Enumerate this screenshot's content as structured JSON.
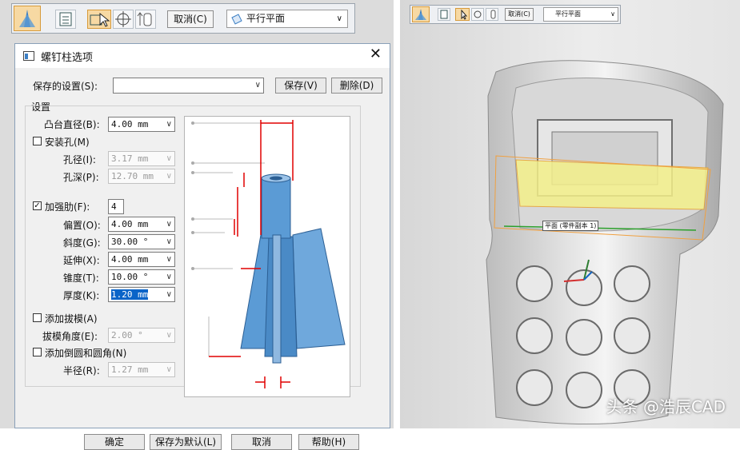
{
  "toolbar": {
    "cancel_label": "取消(C)",
    "plane_option": "平行平面"
  },
  "dialog": {
    "title": "螺钉柱选项",
    "saved_settings_label": "保存的设置(S):",
    "saved_settings_value": "",
    "save_label": "保存(V)",
    "delete_label": "删除(D)",
    "settings_group_label": "设置",
    "boss_diameter_label": "凸台直径(B):",
    "boss_diameter_value": "4.00 mm",
    "mounting_hole_label": "安装孔(M)",
    "mounting_hole_checked": false,
    "hole_diameter_label": "孔径(I):",
    "hole_diameter_value": "3.17 mm",
    "hole_depth_label": "孔深(P):",
    "hole_depth_value": "12.70 mm",
    "ribs_label": "加强肋(F):",
    "ribs_checked": true,
    "ribs_count": "4",
    "offset_label": "偏置(O):",
    "offset_value": "4.00 mm",
    "slope_label": "斜度(G):",
    "slope_value": "30.00 °",
    "extension_label": "延伸(X):",
    "extension_value": "4.00 mm",
    "taper_label": "锥度(T):",
    "taper_value": "10.00 °",
    "thickness_label": "厚度(K):",
    "thickness_value": "1.20 mm",
    "draft_label": "添加拔模(A)",
    "draft_checked": false,
    "draft_angle_label": "拔模角度(E):",
    "draft_angle_value": "2.00 °",
    "fillet_label": "添加倒圆和圆角(N)",
    "fillet_checked": false,
    "radius_label": "半径(R):",
    "radius_value": "1.27 mm",
    "ok_label": "确定",
    "save_default_label": "保存为默认(L)",
    "cancel_label": "取消",
    "help_label": "帮助(H)"
  },
  "viewport": {
    "toolbar_cancel_label": "取消(C)",
    "toolbar_plane_option": "平行平面",
    "plane_tag": "平面 (零件副本 1)",
    "watermark": "头条 @浩辰CAD"
  },
  "colors": {
    "accent": "#f7d9a3",
    "boss_blue": "#5b9bd5",
    "dimension_red": "#e00000",
    "highlight_yellow": "#f4f08a"
  }
}
